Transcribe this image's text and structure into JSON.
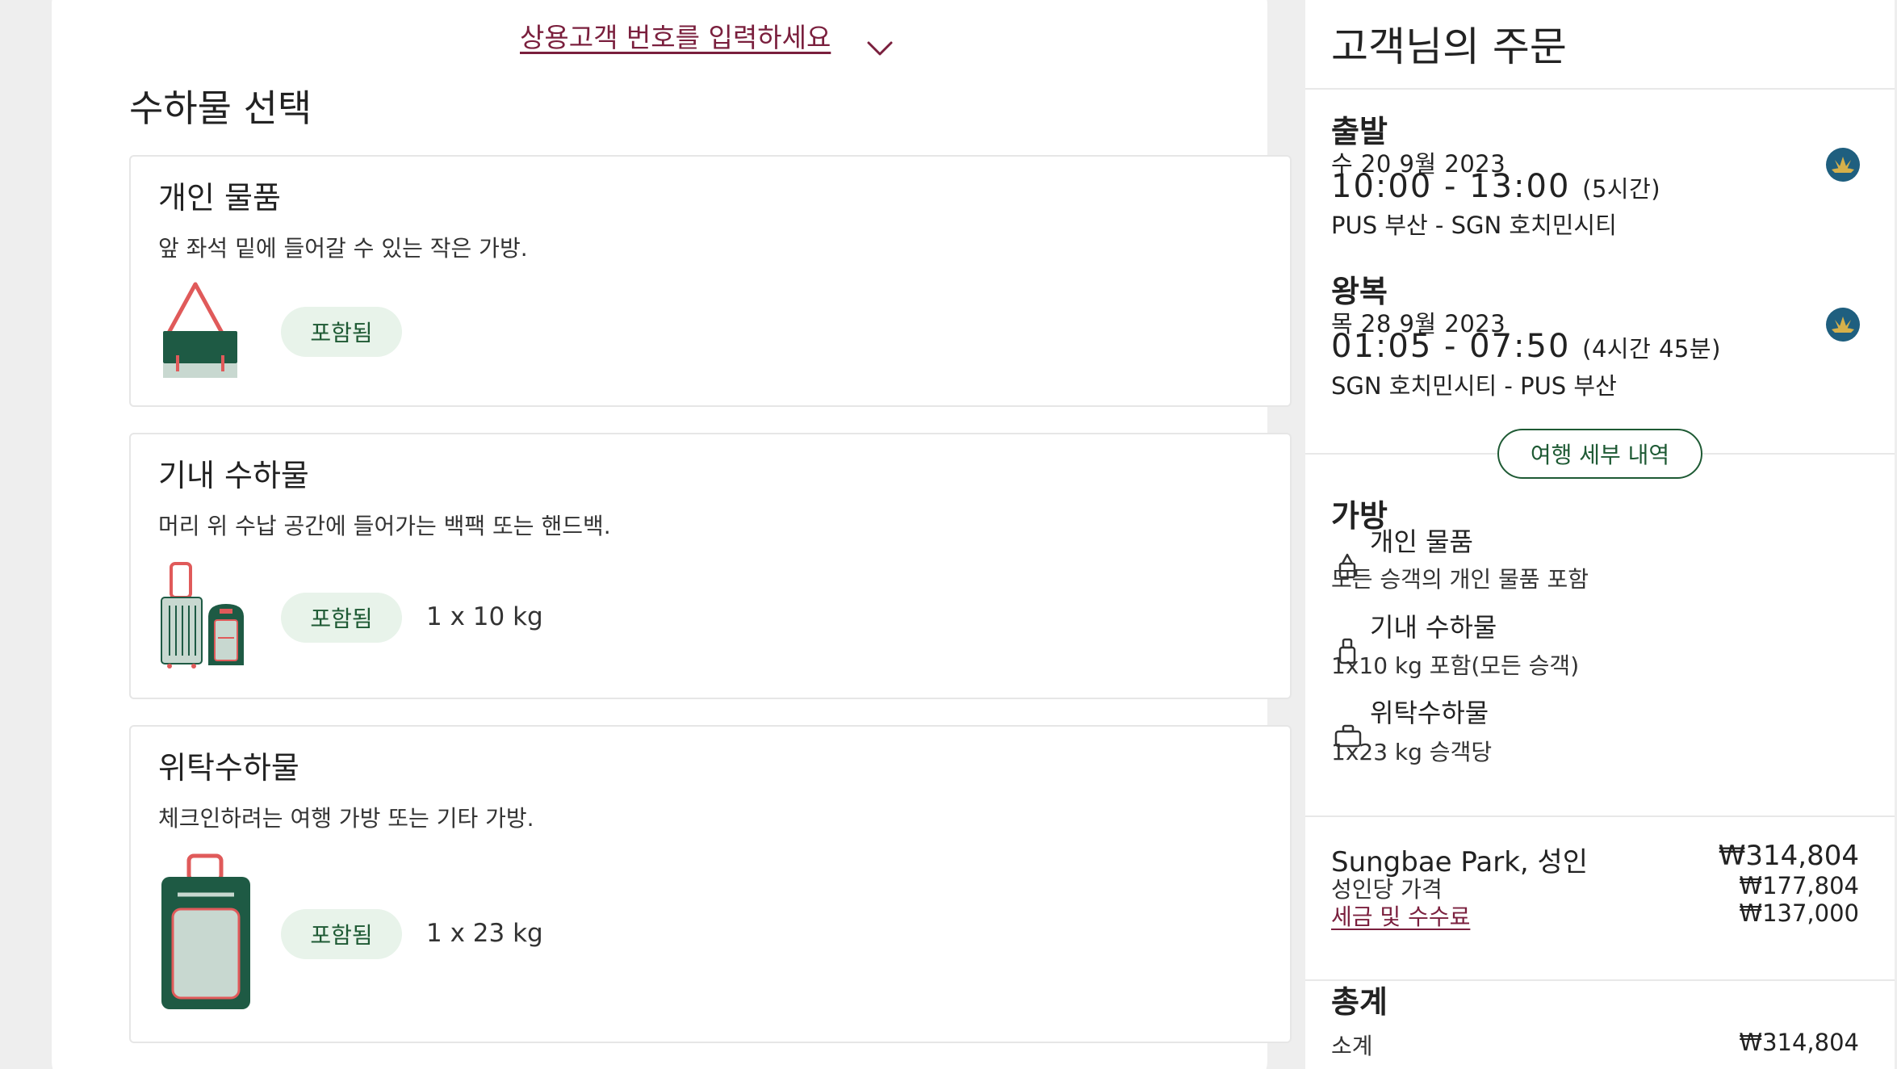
{
  "frequent_flyer": {
    "link_label": "상용고객 번호를 입력하세요"
  },
  "baggage_selection": {
    "title": "수하물 선택",
    "items": [
      {
        "name": "개인 물품",
        "description": "앞 좌석 밑에 들어갈 수 있는 작은 가방.",
        "status": "포함됨",
        "quantity": ""
      },
      {
        "name": "기내 수하물",
        "description": "머리 위 수납 공간에 들어가는 백팩 또는 핸드백.",
        "status": "포함됨",
        "quantity": "1 x 10 kg"
      },
      {
        "name": "위탁수하물",
        "description": "체크인하려는 여행 가방 또는 기타 가방.",
        "status": "포함됨",
        "quantity": "1 x 23 kg"
      }
    ]
  },
  "order": {
    "title": "고객님의 주문",
    "outbound": {
      "label": "출발",
      "date": "수 20 9월 2023",
      "time": "10:00 - 13:00",
      "duration": "(5시간)",
      "route": "PUS 부산 - SGN 호치민시티",
      "airline_icon": "lotus-airline-logo-icon"
    },
    "return": {
      "label": "왕복",
      "date": "목 28 9월 2023",
      "time": "01:05 - 07:50",
      "duration": "(4시간 45분)",
      "route": "SGN 호치민시티 - PUS 부산",
      "airline_icon": "lotus-airline-logo-icon"
    },
    "trip_details_button": "여행 세부 내역",
    "bags": {
      "title": "가방",
      "items": [
        {
          "name": "개인 물품",
          "note": "모든 승객의 개인 물품 포함",
          "icon": "personal-item-icon"
        },
        {
          "name": "기내 수하물",
          "note": "1x10 kg 포함(모든 승객)",
          "icon": "cabin-bag-icon"
        },
        {
          "name": "위탁수하물",
          "note": "1x23 kg 승객당",
          "icon": "checked-bag-icon"
        }
      ]
    },
    "passenger": {
      "name": "Sungbae Park, 성인",
      "price_label": "성인당 가격",
      "tax_label": "세금 및 수수료",
      "total": "₩314,804",
      "fare": "₩177,804",
      "tax": "₩137,000"
    },
    "total": {
      "title": "총계",
      "sub_label": "소계",
      "sub_amount": "₩314,804"
    }
  },
  "colors": {
    "accent_burgundy": "#7a1f3d",
    "brand_green": "#1e5a34",
    "pill_bg": "#e8f3ea",
    "bag_red": "#e05a5a",
    "bag_green": "#1e5a44",
    "bag_light": "#c8d8d0"
  }
}
